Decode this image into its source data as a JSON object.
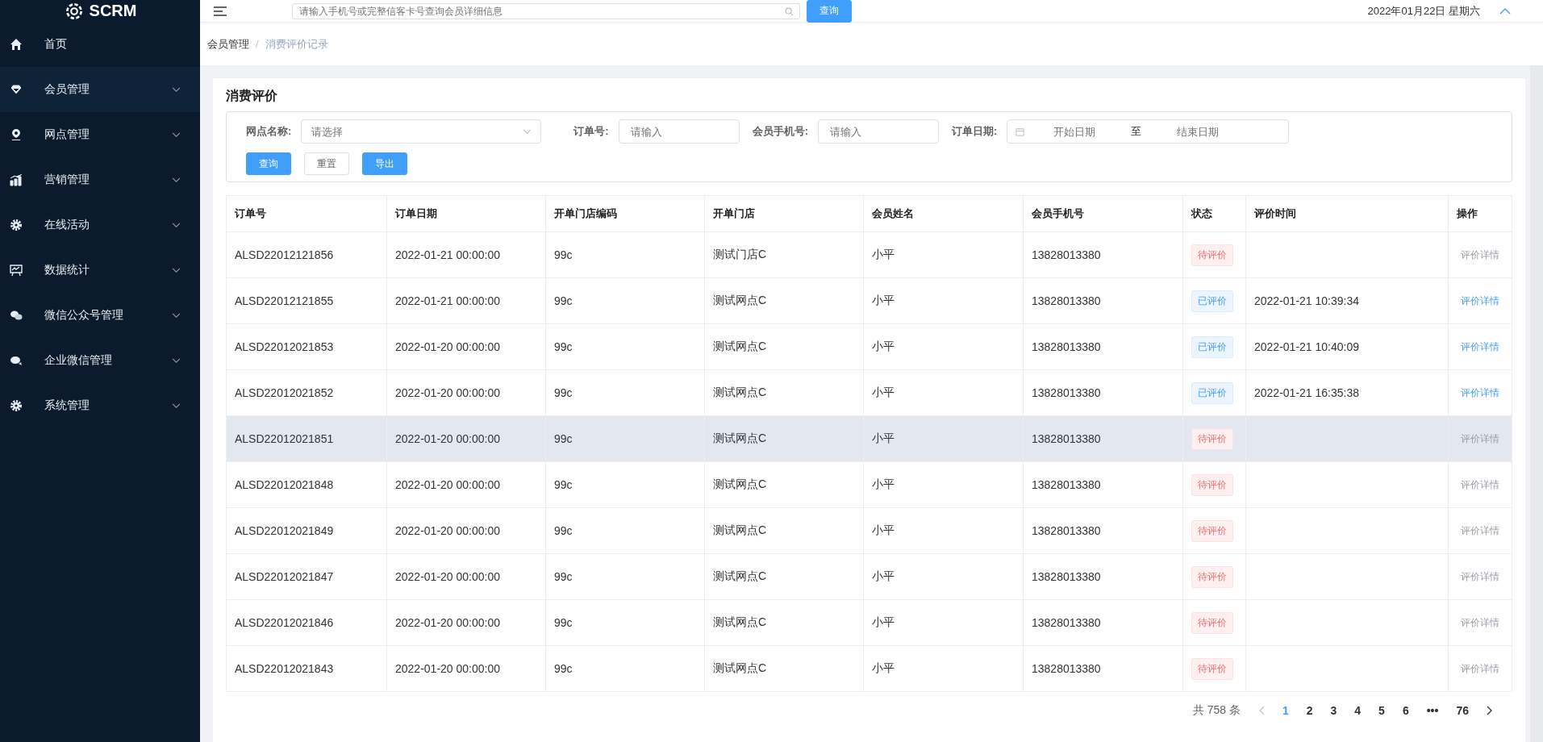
{
  "sidebar": {
    "logo": "SCRM",
    "items": [
      {
        "label": "首页",
        "has_children": false,
        "selected": false
      },
      {
        "label": "会员管理",
        "has_children": true,
        "selected": true
      },
      {
        "label": "网点管理",
        "has_children": true,
        "selected": false
      },
      {
        "label": "营销管理",
        "has_children": true,
        "selected": false
      },
      {
        "label": "在线活动",
        "has_children": true,
        "selected": false
      },
      {
        "label": "数据统计",
        "has_children": true,
        "selected": false
      },
      {
        "label": "微信公众号管理",
        "has_children": true,
        "selected": false
      },
      {
        "label": "企业微信管理",
        "has_children": true,
        "selected": false
      },
      {
        "label": "系统管理",
        "has_children": true,
        "selected": false
      }
    ]
  },
  "header": {
    "search": {
      "placeholder": "请输入手机号或完整信客卡号查询会员详细信息"
    },
    "search_button": "查询",
    "date": "2022年01月22日 星期六"
  },
  "breadcrumb": {
    "separator": "/",
    "items": [
      {
        "label": "会员管理",
        "current": false
      },
      {
        "label": "消费评价记录",
        "current": true
      }
    ]
  },
  "page_title": "消费评价",
  "filters": [
    {
      "kind": "select",
      "label": "网点名称:",
      "placeholder": "请选择"
    },
    {
      "kind": "input",
      "label": "订单号:",
      "placeholder": "请输入"
    },
    {
      "kind": "input",
      "label": "会员手机号:",
      "placeholder": "请输入"
    },
    {
      "kind": "daterange",
      "label": "订单日期:",
      "start_placeholder": "开始日期",
      "separator": "至",
      "end_placeholder": "结束日期"
    }
  ],
  "buttons": [
    {
      "label": "查询",
      "kind": "primary"
    },
    {
      "label": "重置",
      "kind": "default"
    },
    {
      "label": "导出",
      "kind": "primary"
    }
  ],
  "table": {
    "columns": [
      "订单号",
      "订单日期",
      "开单门店编码",
      "开单门店",
      "会员姓名",
      "会员手机号",
      "状态",
      "评价时间",
      "操作"
    ],
    "rows": [
      {
        "order": "ALSD22012121856",
        "date": "2022-01-21 00:00:00",
        "store_code": "99c",
        "store": "测试门店C",
        "name": "小平",
        "phone": "13828013380",
        "status": {
          "text": "待评价",
          "kind": "pending"
        },
        "review_time": "",
        "action": "评价详情",
        "action_disabled": true,
        "highlighted": false
      },
      {
        "order": "ALSD22012121855",
        "date": "2022-01-21 00:00:00",
        "store_code": "99c",
        "store": "测试网点C",
        "name": "小平",
        "phone": "13828013380",
        "status": {
          "text": "已评价",
          "kind": "done"
        },
        "review_time": "2022-01-21 10:39:34",
        "action": "评价详情",
        "action_disabled": false,
        "highlighted": false
      },
      {
        "order": "ALSD22012021853",
        "date": "2022-01-20 00:00:00",
        "store_code": "99c",
        "store": "测试网点C",
        "name": "小平",
        "phone": "13828013380",
        "status": {
          "text": "已评价",
          "kind": "done"
        },
        "review_time": "2022-01-21 10:40:09",
        "action": "评价详情",
        "action_disabled": false,
        "highlighted": false
      },
      {
        "order": "ALSD22012021852",
        "date": "2022-01-20 00:00:00",
        "store_code": "99c",
        "store": "测试网点C",
        "name": "小平",
        "phone": "13828013380",
        "status": {
          "text": "已评价",
          "kind": "done"
        },
        "review_time": "2022-01-21 16:35:38",
        "action": "评价详情",
        "action_disabled": false,
        "highlighted": false
      },
      {
        "order": "ALSD22012021851",
        "date": "2022-01-20 00:00:00",
        "store_code": "99c",
        "store": "测试网点C",
        "name": "小平",
        "phone": "13828013380",
        "status": {
          "text": "待评价",
          "kind": "pending"
        },
        "review_time": "",
        "action": "评价详情",
        "action_disabled": true,
        "highlighted": true
      },
      {
        "order": "ALSD22012021848",
        "date": "2022-01-20 00:00:00",
        "store_code": "99c",
        "store": "测试网点C",
        "name": "小平",
        "phone": "13828013380",
        "status": {
          "text": "待评价",
          "kind": "pending"
        },
        "review_time": "",
        "action": "评价详情",
        "action_disabled": true,
        "highlighted": false
      },
      {
        "order": "ALSD22012021849",
        "date": "2022-01-20 00:00:00",
        "store_code": "99c",
        "store": "测试网点C",
        "name": "小平",
        "phone": "13828013380",
        "status": {
          "text": "待评价",
          "kind": "pending"
        },
        "review_time": "",
        "action": "评价详情",
        "action_disabled": true,
        "highlighted": false
      },
      {
        "order": "ALSD22012021847",
        "date": "2022-01-20 00:00:00",
        "store_code": "99c",
        "store": "测试网点C",
        "name": "小平",
        "phone": "13828013380",
        "status": {
          "text": "待评价",
          "kind": "pending"
        },
        "review_time": "",
        "action": "评价详情",
        "action_disabled": true,
        "highlighted": false
      },
      {
        "order": "ALSD22012021846",
        "date": "2022-01-20 00:00:00",
        "store_code": "99c",
        "store": "测试网点C",
        "name": "小平",
        "phone": "13828013380",
        "status": {
          "text": "待评价",
          "kind": "pending"
        },
        "review_time": "",
        "action": "评价详情",
        "action_disabled": true,
        "highlighted": false
      },
      {
        "order": "ALSD22012021843",
        "date": "2022-01-20 00:00:00",
        "store_code": "99c",
        "store": "测试网点C",
        "name": "小平",
        "phone": "13828013380",
        "status": {
          "text": "待评价",
          "kind": "pending"
        },
        "review_time": "",
        "action": "评价详情",
        "action_disabled": true,
        "highlighted": false
      }
    ]
  },
  "pagination": {
    "total": "共 758 条",
    "pages": [
      {
        "label": "1",
        "selected": true
      },
      {
        "label": "2",
        "selected": false
      },
      {
        "label": "3",
        "selected": false
      },
      {
        "label": "4",
        "selected": false
      },
      {
        "label": "5",
        "selected": false
      },
      {
        "label": "6",
        "selected": false
      },
      {
        "label": "•••",
        "selected": false
      },
      {
        "label": "76",
        "selected": false
      }
    ]
  }
}
